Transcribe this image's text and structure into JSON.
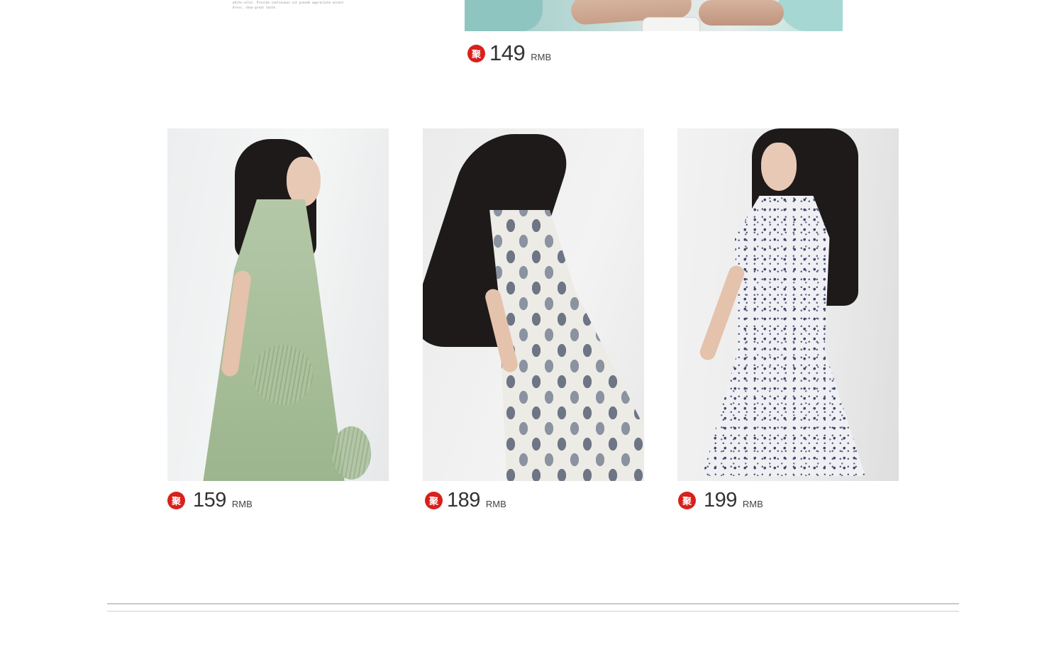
{
  "top_block": {
    "fragment_text": "white-color. Provide continuous cut pseudo appreciate accent\ndress, show great taste.",
    "price": {
      "badge": "聚",
      "amount": "149",
      "unit": "RMB"
    }
  },
  "products": [
    {
      "name": "green-dress",
      "price": {
        "badge": "聚",
        "amount": "159",
        "unit": "RMB"
      }
    },
    {
      "name": "leaf-print-dress",
      "price": {
        "badge": "聚",
        "amount": "189",
        "unit": "RMB"
      }
    },
    {
      "name": "floral-shirt-dress",
      "price": {
        "badge": "聚",
        "amount": "199",
        "unit": "RMB"
      }
    }
  ],
  "colors": {
    "badge": "#d9201c",
    "divider": "#c9c9c9",
    "background": "#ffffff"
  }
}
